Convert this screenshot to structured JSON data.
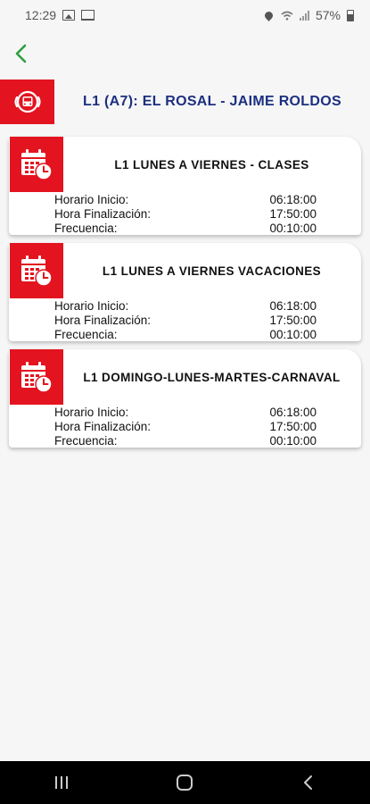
{
  "status_bar": {
    "time": "12:29",
    "battery": "57%"
  },
  "icons": {
    "back": "chevron-left-icon",
    "route": "bus-route-icon",
    "schedule": "calendar-clock-icon"
  },
  "colors": {
    "accent_red": "#e3141f",
    "title_blue": "#1c2f80",
    "back_green": "#2e9e3e"
  },
  "route": {
    "title": "L1 (A7): EL ROSAL - JAIME ROLDOS"
  },
  "schedules": [
    {
      "title": "L1 LUNES A VIERNES - CLASES",
      "rows": [
        {
          "label": "Horario Inicio:",
          "value": "06:18:00"
        },
        {
          "label": "Hora Finalización:",
          "value": "17:50:00"
        },
        {
          "label": "Frecuencia:",
          "value": "00:10:00"
        }
      ]
    },
    {
      "title": "L1 LUNES A VIERNES VACACIONES",
      "rows": [
        {
          "label": "Horario Inicio:",
          "value": "06:18:00"
        },
        {
          "label": "Hora Finalización:",
          "value": "17:50:00"
        },
        {
          "label": "Frecuencia:",
          "value": "00:10:00"
        }
      ]
    },
    {
      "title": "L1 DOMINGO-LUNES-MARTES-CARNAVAL",
      "rows": [
        {
          "label": "Horario Inicio:",
          "value": "06:18:00"
        },
        {
          "label": "Hora Finalización:",
          "value": "17:50:00"
        },
        {
          "label": "Frecuencia:",
          "value": "00:10:00"
        }
      ]
    }
  ]
}
